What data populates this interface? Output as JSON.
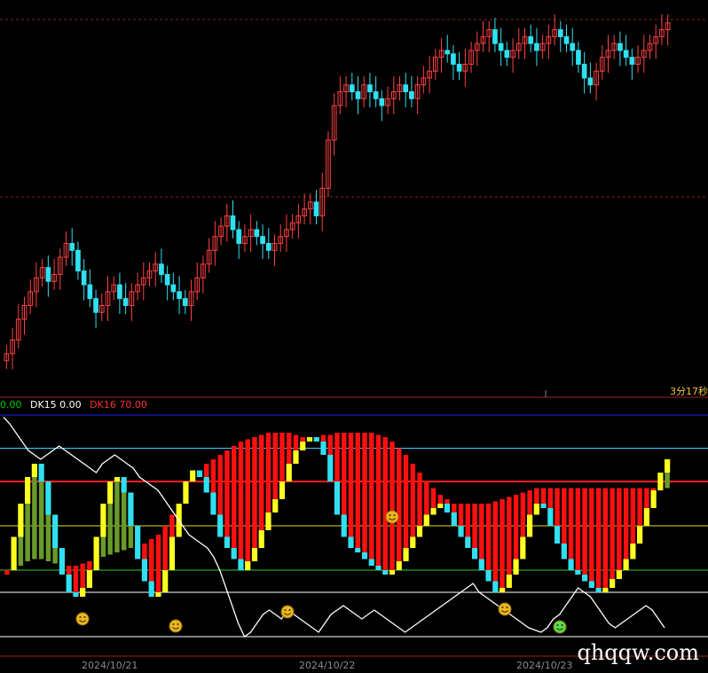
{
  "indicator_legend": [
    {
      "label": "0.00",
      "color": "#00cc00"
    },
    {
      "label": "DK15 0.00",
      "color": "#ffffff"
    },
    {
      "label": "DK16 70.00",
      "color": "#ff3030"
    }
  ],
  "timeframe_label": "3分17秒",
  "watermark": "qhqqw.com",
  "colors": {
    "background": "#000000",
    "candle_up": "#ff4040",
    "candle_down": "#30e0f0",
    "indicator_up": "#ffff20",
    "indicator_down": "#30e0f0",
    "ribbon_bull": "#ff1010",
    "ribbon_bear": "#6a9a2a",
    "white_line": "#ffffff"
  },
  "chart_data": [
    {
      "type": "candlestick",
      "title": "",
      "x_dates": [
        "2024/10/21",
        "2024/10/22",
        "2024/10/23"
      ],
      "price_range": [
        0,
        100
      ],
      "grid": "dashed horizontal reference lines at price levels 100 and 50",
      "closes": [
        8,
        12,
        18,
        22,
        26,
        30,
        33,
        29,
        31,
        36,
        40,
        38,
        32,
        28,
        24,
        20,
        22,
        26,
        28,
        24,
        22,
        26,
        28,
        30,
        32,
        34,
        31,
        28,
        26,
        24,
        22,
        26,
        30,
        34,
        38,
        42,
        45,
        48,
        44,
        40,
        42,
        44,
        42,
        40,
        38,
        40,
        42,
        44,
        46,
        48,
        50,
        52,
        48,
        56,
        70,
        80,
        84,
        86,
        84,
        82,
        86,
        84,
        82,
        80,
        82,
        84,
        86,
        84,
        82,
        86,
        88,
        90,
        94,
        96,
        95,
        92,
        90,
        92,
        96,
        98,
        100,
        102,
        98,
        96,
        94,
        96,
        98,
        100,
        98,
        96,
        98,
        100,
        102,
        100,
        98,
        96,
        92,
        88,
        86,
        90,
        94,
        96,
        98,
        96,
        94,
        92,
        94,
        96,
        98,
        100,
        102,
        104
      ]
    },
    {
      "type": "indicator",
      "title": "",
      "series": [
        {
          "name": "DK15",
          "values": [
            0.0
          ]
        },
        {
          "name": "DK16",
          "values": [
            70.0
          ]
        }
      ],
      "reference_levels": [
        85,
        70,
        50,
        30,
        20
      ],
      "oscillator": [
        30,
        45,
        60,
        72,
        78,
        70,
        55,
        40,
        28,
        20,
        18,
        22,
        30,
        45,
        60,
        70,
        72,
        65,
        50,
        35,
        25,
        18,
        20,
        30,
        45,
        60,
        70,
        75,
        72,
        65,
        55,
        45,
        40,
        35,
        30,
        34,
        40,
        48,
        56,
        62,
        70,
        78,
        84,
        88,
        90,
        88,
        82,
        70,
        55,
        45,
        40,
        38,
        35,
        32,
        30,
        28,
        30,
        34,
        40,
        45,
        50,
        55,
        58,
        60,
        56,
        50,
        45,
        40,
        35,
        30,
        25,
        20,
        22,
        28,
        35,
        45,
        55,
        60,
        58,
        50,
        42,
        35,
        30,
        28,
        25,
        22,
        20,
        22,
        26,
        30,
        35,
        42,
        50,
        58,
        66,
        74,
        80
      ],
      "signal": [
        28,
        30,
        32,
        34,
        35,
        35,
        34,
        33,
        32,
        32,
        32,
        33,
        34,
        35,
        36,
        37,
        38,
        39,
        40,
        41,
        42,
        44,
        46,
        50,
        55,
        60,
        65,
        70,
        74,
        78,
        80,
        82,
        84,
        86,
        88,
        89,
        90,
        91,
        92,
        92,
        92,
        92,
        91,
        90,
        90,
        90,
        91,
        91,
        92,
        92,
        92,
        92,
        92,
        92,
        91,
        90,
        88,
        85,
        82,
        78,
        74,
        70,
        67,
        64,
        62,
        60,
        60,
        60,
        60,
        60,
        60,
        61,
        62,
        63,
        64,
        65,
        66,
        67,
        67,
        67,
        67,
        67,
        67,
        67,
        67,
        67,
        67,
        67,
        67,
        67,
        67,
        67,
        67,
        67,
        67,
        67,
        67
      ],
      "white_line": [
        99,
        96,
        92,
        88,
        84,
        82,
        80,
        82,
        84,
        86,
        84,
        82,
        80,
        78,
        76,
        74,
        78,
        80,
        82,
        80,
        78,
        76,
        72,
        70,
        68,
        66,
        62,
        58,
        54,
        50,
        46,
        44,
        42,
        40,
        36,
        30,
        22,
        14,
        6,
        0,
        2,
        6,
        10,
        12,
        10,
        8,
        12,
        10,
        8,
        6,
        4,
        2,
        6,
        10,
        12,
        14,
        12,
        10,
        8,
        10,
        12,
        10,
        8,
        6,
        4,
        2,
        4,
        6,
        8,
        10,
        12,
        14,
        16,
        18,
        20,
        22,
        24,
        20,
        18,
        16,
        14,
        12,
        10,
        8,
        6,
        4,
        3,
        2,
        4,
        8,
        10,
        14,
        18,
        22,
        20,
        18,
        14,
        10,
        6,
        4,
        6,
        8,
        10,
        12,
        14,
        12,
        8,
        4
      ],
      "smileys": [
        {
          "color": "#e8b820"
        },
        {
          "color": "#e8b820"
        },
        {
          "color": "#e8b820"
        },
        {
          "color": "#e8b820"
        },
        {
          "color": "#e8b820"
        },
        {
          "color": "#50e050"
        }
      ]
    }
  ],
  "date_labels": [
    "2024/10/21",
    "2024/10/22",
    "2024/10/23"
  ]
}
